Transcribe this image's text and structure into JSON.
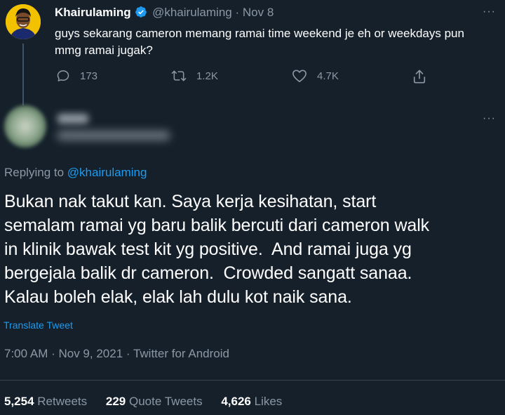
{
  "parent_tweet": {
    "author_name": "Khairulaming",
    "author_handle": "@khairulaming",
    "date": "Nov 8",
    "text": "guys sekarang cameron memang ramai time weekend je eh or weekdays pun mmg ramai jugak?",
    "more_label": "···",
    "actions": {
      "replies": "173",
      "retweets": "1.2K",
      "likes": "4.7K"
    },
    "icons": {
      "reply": "reply-icon",
      "retweet": "retweet-icon",
      "like": "heart-icon",
      "share": "share-icon"
    }
  },
  "reply_tweet": {
    "more_label": "···",
    "replying_prefix": "Replying to",
    "replying_to": "@khairulaming",
    "lines": [
      "Bukan nak takut kan. Saya kerja kesihatan, start",
      "semalam ramai yg baru balik bercuti dari cameron walk",
      "in klinik bawak test kit yg positive.  And ramai juga yg",
      "bergejala balik dr cameron.  Crowded sangatt sanaa.",
      "Kalau boleh elak, elak lah dulu kot naik sana."
    ],
    "translate_label": "Translate Tweet",
    "timestamp": "7:00 AM · Nov 9, 2021 · Twitter for Android"
  },
  "stats": {
    "retweets_count": "5,254",
    "retweets_label": "Retweets",
    "quote_count": "229",
    "quote_label": "Quote Tweets",
    "likes_count": "4,626",
    "likes_label": "Likes"
  },
  "colors": {
    "background": "#15202b",
    "muted": "#8b98a5",
    "accent": "#1d9bf0",
    "divider": "#38444d"
  }
}
